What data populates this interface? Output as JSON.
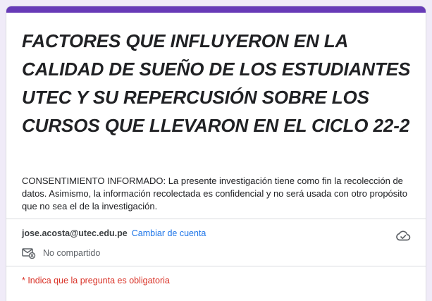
{
  "form": {
    "title": "FACTORES QUE INFLUYERON EN LA CALIDAD DE SUEÑO DE LOS ESTUDIANTES UTEC Y SU REPERCUSIÓN SOBRE LOS CURSOS QUE LLEVARON EN EL CICLO 22-2",
    "description": "CONSENTIMIENTO INFORMADO: La presente investigación tiene como fin la recolección de datos. Asimismo, la información recolectada es confidencial y no será usada con otro propósito que no sea el de la investigación."
  },
  "account": {
    "email": "jose.acosta@utec.edu.pe",
    "switch_label": "Cambiar de cuenta",
    "sharing_status": "No compartido",
    "cloud_icon": "cloud-done-icon",
    "sharing_icon": "mail-not-shared-icon"
  },
  "required_note": "* Indica que la pregunta es obligatoria",
  "colors": {
    "accent": "#673ab7",
    "background": "#f0ebf8",
    "link": "#1a73e8",
    "required": "#d93025"
  }
}
